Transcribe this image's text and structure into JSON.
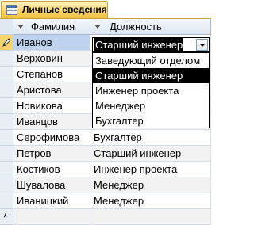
{
  "tab": {
    "label": "Личные сведения",
    "icon": "table-icon"
  },
  "columns": [
    {
      "label": "Фамилия"
    },
    {
      "label": "Должность"
    }
  ],
  "rows": [
    {
      "surname": "Иванов",
      "position": ""
    },
    {
      "surname": "Верховин",
      "position": ""
    },
    {
      "surname": "Степанов",
      "position": ""
    },
    {
      "surname": "Аристова",
      "position": ""
    },
    {
      "surname": "Новикова",
      "position": ""
    },
    {
      "surname": "Иванцов",
      "position": ""
    },
    {
      "surname": "Серофимова",
      "position": "Бухгалтер"
    },
    {
      "surname": "Петров",
      "position": "Старший инженер"
    },
    {
      "surname": "Костиков",
      "position": "Инженер проекта"
    },
    {
      "surname": "Шувалова",
      "position": "Менеджер"
    },
    {
      "surname": "Иваницкий",
      "position": "Менеджер"
    }
  ],
  "combo": {
    "value": "Старший инженер"
  },
  "dropdown": {
    "options": [
      "Заведующий отделом",
      "Старший инженер",
      "Инженер проекта",
      "Менеджер",
      "Бухгалтер"
    ],
    "selected_index": 1
  },
  "new_row_marker": "*",
  "colors": {
    "tab": "#f7d56c",
    "current_selector": "#f7d56c",
    "current_cell": "#bed3f0",
    "highlight": "#000000"
  }
}
